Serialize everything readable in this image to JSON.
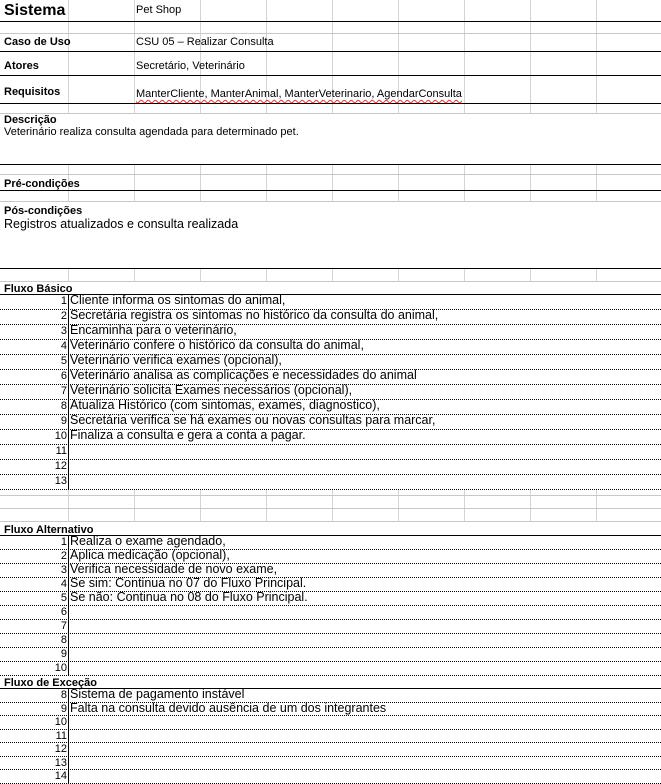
{
  "sistema": {
    "label": "Sistema",
    "value": "Pet Shop"
  },
  "caso_de_uso": {
    "label": "Caso de Uso",
    "value": "CSU 05 – Realizar Consulta"
  },
  "atores": {
    "label": "Atores",
    "value": "Secretário, Veterinário"
  },
  "requisitos": {
    "label": "Requisitos",
    "value": "ManterCliente, ManterAnimal, ManterVeterinario, AgendarConsulta"
  },
  "descricao": {
    "label": "Descrição",
    "value": "Veterinário realiza consulta agendada para determinado pet."
  },
  "pre_condicoes": {
    "label": "Pré-condições",
    "value": ""
  },
  "pos_condicoes": {
    "label": "Pós-condições",
    "value": "Registros atualizados e consulta realizada"
  },
  "fluxo_basico": {
    "label": "Fluxo Básico",
    "steps": [
      {
        "n": "1",
        "text": "Cliente informa os sintomas do animal,"
      },
      {
        "n": "2",
        "text": "Secretária registra os sintomas no histórico da consulta do animal,"
      },
      {
        "n": "3",
        "text": "Encaminha para o veterinário,"
      },
      {
        "n": "4",
        "text": "Veterinário confere o histórico da consulta do animal,"
      },
      {
        "n": "5",
        "text": "Veterinário verifica exames (opcional),"
      },
      {
        "n": "6",
        "text": "Veterinário analisa as complicações e necessidades do animal"
      },
      {
        "n": "7",
        "text": "Veterinário solicita Exames necessários (opcional),"
      },
      {
        "n": "8",
        "text": "Atualiza Histórico (com sintomas, exames, diagnostico),"
      },
      {
        "n": "9",
        "text": "Secretária verifica se há exames ou novas consultas para marcar,"
      },
      {
        "n": "10",
        "text": "Finaliza a consulta e gera a conta a pagar."
      },
      {
        "n": "11",
        "text": ""
      },
      {
        "n": "12",
        "text": ""
      },
      {
        "n": "13",
        "text": ""
      }
    ]
  },
  "fluxo_alternativo": {
    "label": "Fluxo Alternativo",
    "steps": [
      {
        "n": "1",
        "text": "Realiza o exame agendado,"
      },
      {
        "n": "2",
        "text": "Aplica medicação (opcional),"
      },
      {
        "n": "3",
        "text": "Verifica necessidade de novo exame,"
      },
      {
        "n": "4",
        "text": "Se sim: Continua no 07 do Fluxo Principal."
      },
      {
        "n": "5",
        "text": "Se não: Continua no 08 do Fluxo Principal."
      },
      {
        "n": "6",
        "text": ""
      },
      {
        "n": "7",
        "text": ""
      },
      {
        "n": "8",
        "text": ""
      },
      {
        "n": "9",
        "text": ""
      },
      {
        "n": "10",
        "text": ""
      }
    ]
  },
  "fluxo_excecao": {
    "label": "Fluxo de Exceção",
    "steps": [
      {
        "n": "8",
        "text": "Sistema de pagamento instável"
      },
      {
        "n": "9",
        "text": "Falta na consulta devido ausência de um dos integrantes"
      },
      {
        "n": "10",
        "text": ""
      },
      {
        "n": "11",
        "text": ""
      },
      {
        "n": "12",
        "text": ""
      },
      {
        "n": "13",
        "text": ""
      },
      {
        "n": "14",
        "text": ""
      }
    ]
  }
}
